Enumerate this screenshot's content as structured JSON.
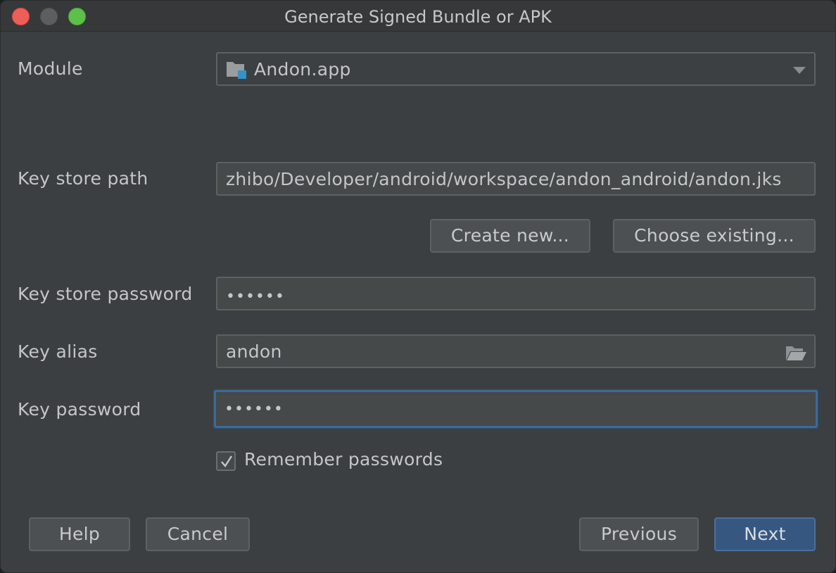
{
  "window": {
    "title": "Generate Signed Bundle or APK"
  },
  "form": {
    "module_label": "Module",
    "module_value": "Andon.app",
    "keystore_path_label": "Key store path",
    "keystore_path_value": "zhibo/Developer/android/workspace/andon_android/andon.jks",
    "create_new_label": "Create new...",
    "choose_existing_label": "Choose existing...",
    "keystore_password_label": "Key store password",
    "keystore_password_value": "••••••",
    "key_alias_label": "Key alias",
    "key_alias_value": "andon",
    "key_password_label": "Key password",
    "key_password_value": "••••••",
    "remember_passwords_label": "Remember passwords",
    "remember_passwords_checked": true
  },
  "footer": {
    "help_label": "Help",
    "cancel_label": "Cancel",
    "previous_label": "Previous",
    "next_label": "Next"
  },
  "icons": {
    "module": "module-folder-icon",
    "dropdown": "chevron-down-icon",
    "alias_browse": "folder-open-icon",
    "check": "checkmark-icon"
  },
  "colors": {
    "background": "#3c3f41",
    "field_background": "#45494a",
    "focus_border": "#3c6a99",
    "primary_button": "#365880",
    "text": "#c4c6c8"
  }
}
